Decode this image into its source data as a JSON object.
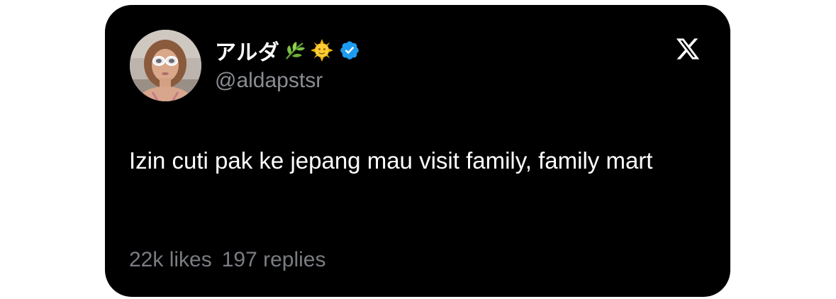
{
  "tweet": {
    "author": {
      "display_name": "アルダ",
      "display_name_emojis": [
        "herb-icon",
        "sun-with-face-icon"
      ],
      "verified": true,
      "handle": "@aldapstsr"
    },
    "text": "Izin cuti pak ke jepang mau visit family, family mart",
    "stats": {
      "likes": "22k likes",
      "replies": "197 replies"
    }
  },
  "brand": {
    "logo": "x-logo-icon",
    "verified_color": "#1d9bf0",
    "card_bg": "#000000"
  }
}
